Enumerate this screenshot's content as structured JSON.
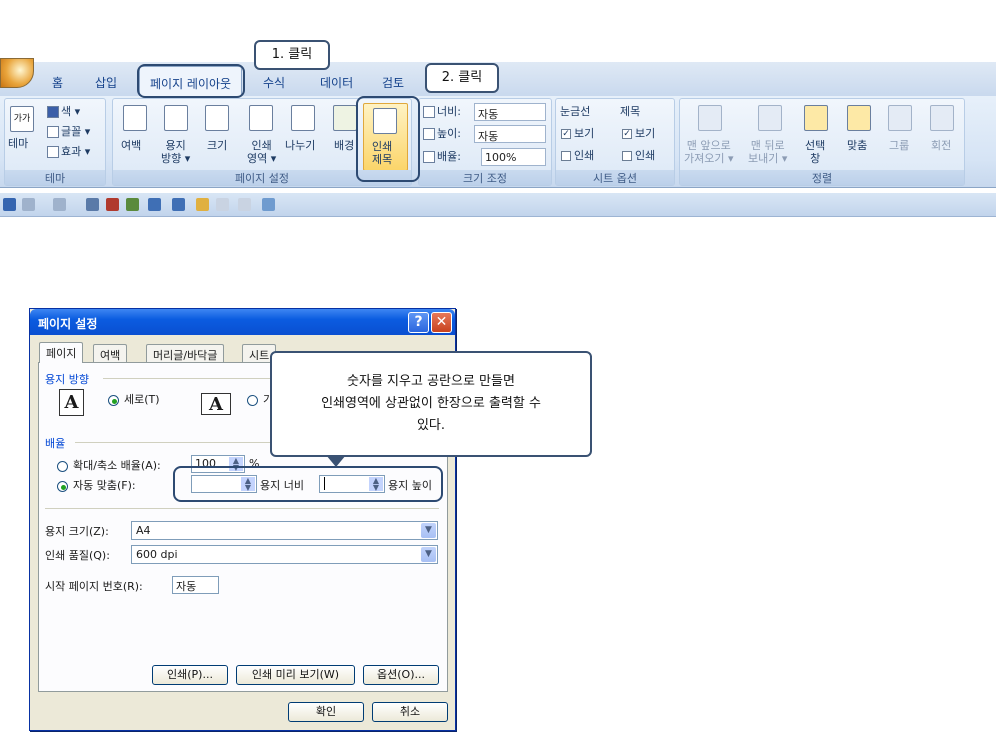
{
  "ribbon": {
    "tabs": [
      "홈",
      "삽입",
      "페이지 레이아웃",
      "수식",
      "데이터",
      "검토"
    ],
    "active_tab": "페이지 레이아웃",
    "theme_group": {
      "label": "테마",
      "theme_button": "테마",
      "colors": "색 ▾",
      "fonts": "글꼴 ▾",
      "effects": "효과 ▾"
    },
    "page_setup_group": {
      "label": "페이지 설정",
      "margins": "여백",
      "orientation": "용지\n방향 ▾",
      "size": "크기",
      "print_area": "인쇄\n영역 ▾",
      "breaks": "나누기",
      "background": "배경",
      "print_titles": "인쇄\n제목"
    },
    "scale_group": {
      "label": "크기 조정",
      "width_label": "너비:",
      "width_value": "자동",
      "height_label": "높이:",
      "height_value": "자동",
      "scale_label": "배율:",
      "scale_value": "100%"
    },
    "sheet_options_group": {
      "label": "시트 옵션",
      "gridlines": "눈금선",
      "headings": "제목",
      "view": "보기",
      "print": "인쇄"
    },
    "arrange_group": {
      "label": "정렬",
      "bring_front": "맨 앞으로\n가져오기 ▾",
      "send_back": "맨 뒤로\n보내기 ▾",
      "selection_pane": "선택\n창",
      "align": "맞춤",
      "group": "그룹",
      "rotate": "회전"
    }
  },
  "callouts": {
    "step1": "1. 클릭",
    "step2": "2. 클릭",
    "note": "숫자를 지우고 공란으로 만들면\n인쇄영역에 상관없이 한장으로 출력할 수\n있다."
  },
  "dialog": {
    "title": "페이지 설정",
    "tabs": [
      "페이지",
      "여백",
      "머리글/바닥글",
      "시트"
    ],
    "orientation_section": "용지 방향",
    "portrait": "세로(T)",
    "landscape_partial": "기",
    "scaling_section": "배율",
    "adjust_to": "확대/축소 배율(A):",
    "adjust_value": "100",
    "percent": "%",
    "fit_to": "자동 맞춤(F):",
    "pages_wide_label": "용지 너비",
    "pages_tall_label": "용지 높이",
    "paper_size_label": "용지 크기(Z):",
    "paper_size_value": "A4",
    "print_quality_label": "인쇄 품질(Q):",
    "print_quality_value": "600 dpi",
    "first_page_label": "시작 페이지 번호(R):",
    "first_page_value": "자동",
    "print_button": "인쇄(P)...",
    "preview_button": "인쇄 미리 보기(W)",
    "options_button": "옵션(O)...",
    "ok_button": "확인",
    "cancel_button": "취소"
  }
}
